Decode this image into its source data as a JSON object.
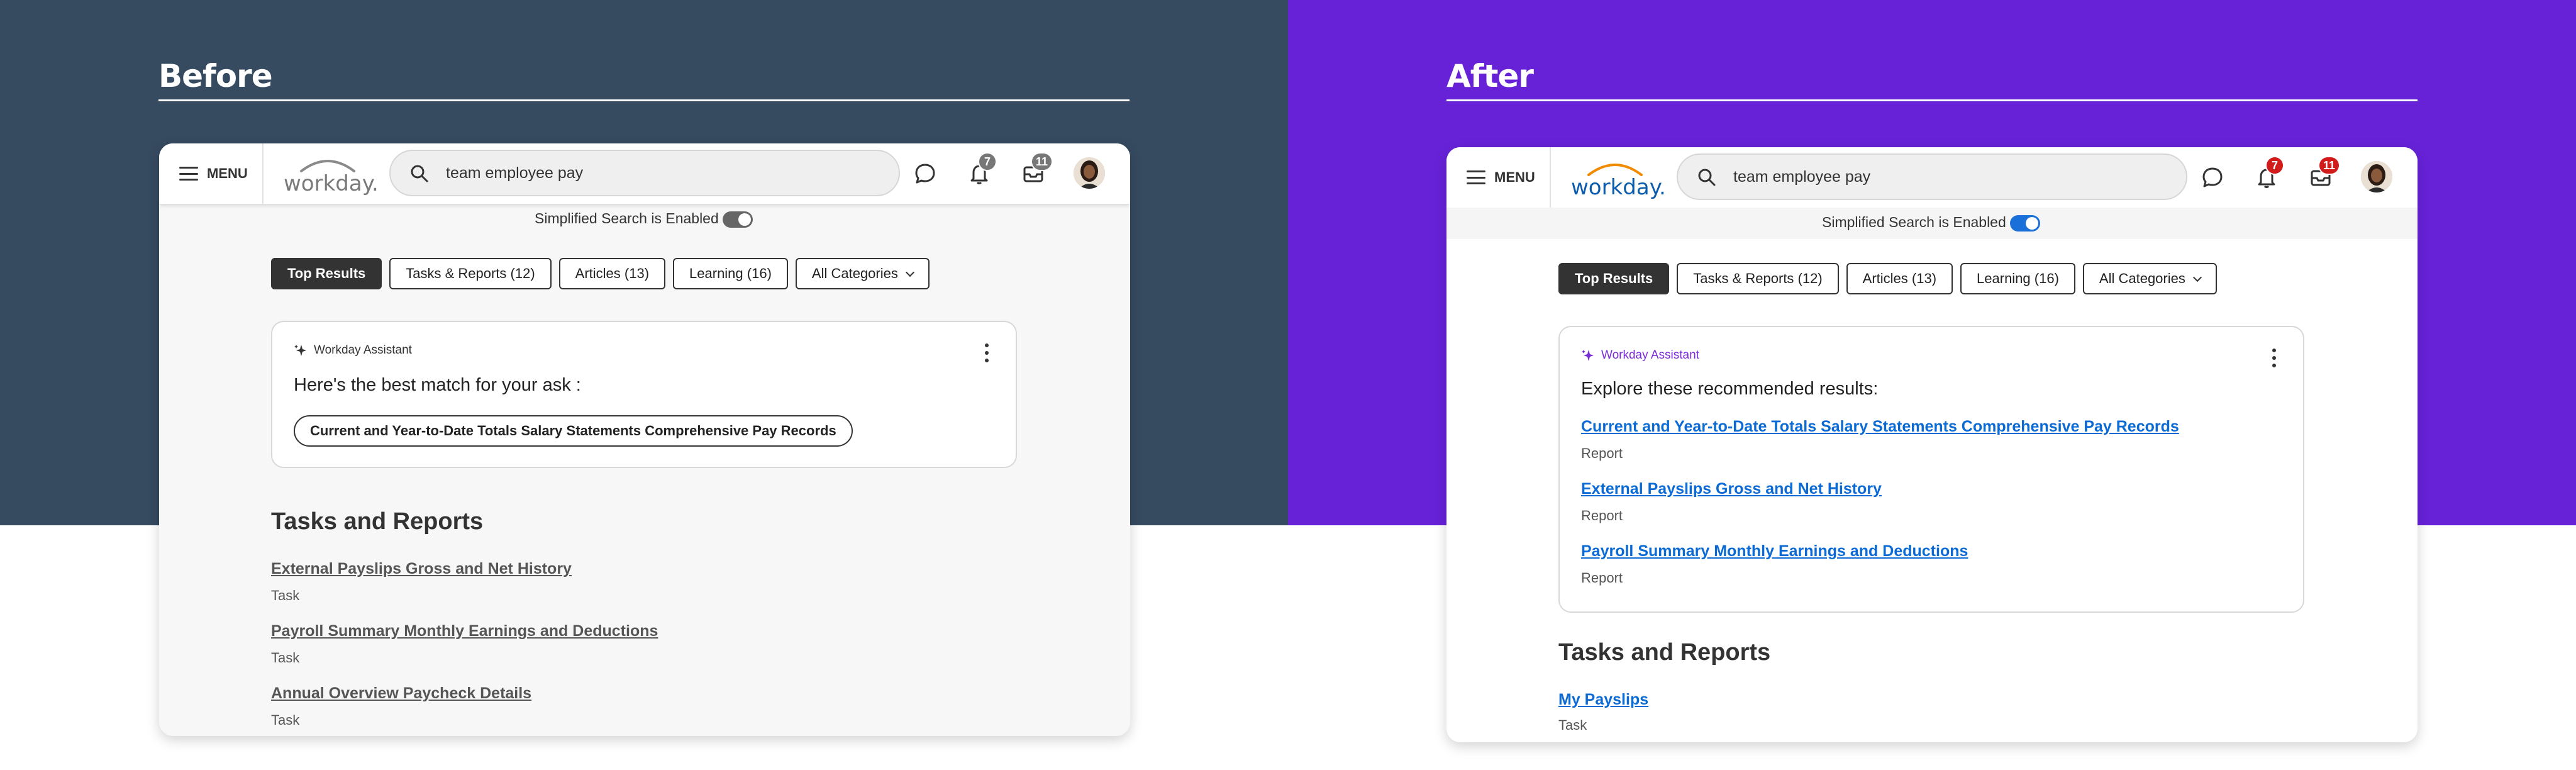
{
  "before": {
    "heading": "Before",
    "menu_label": "MENU",
    "logo_text": "workday.",
    "search_value": "team employee pay",
    "notifications_count": "7",
    "inbox_count": "11",
    "simplified_label": "Simplified Search is Enabled",
    "simplified_toggle_on": false,
    "chips": [
      "Top Results",
      "Tasks & Reports (12)",
      "Articles (13)",
      "Learning (16)",
      "All Categories"
    ],
    "assistant": {
      "label": "Workday Assistant",
      "title": "Here's the best match for your ask :",
      "best_match": "Current and Year-to-Date Totals Salary Statements Comprehensive Pay Records"
    },
    "section_title": "Tasks and Reports",
    "tasks": [
      {
        "title": "External Payslips Gross and Net History",
        "type": "Task"
      },
      {
        "title": "Payroll Summary Monthly Earnings and Deductions",
        "type": "Task"
      },
      {
        "title": "Annual Overview Paycheck Details",
        "type": "Task"
      }
    ]
  },
  "after": {
    "heading": "After",
    "menu_label": "MENU",
    "logo_text": "workday.",
    "search_value": "team employee pay",
    "notifications_count": "7",
    "inbox_count": "11",
    "simplified_label": "Simplified Search is Enabled",
    "simplified_toggle_on": true,
    "chips": [
      "Top Results",
      "Tasks & Reports (12)",
      "Articles (13)",
      "Learning (16)",
      "All Categories"
    ],
    "assistant": {
      "label": "Workday Assistant",
      "title": "Explore these recommended results:",
      "results": [
        {
          "title": "Current and Year-to-Date Totals Salary Statements Comprehensive Pay Records",
          "type": "Report"
        },
        {
          "title": "External Payslips Gross and Net History",
          "type": "Report"
        },
        {
          "title": "Payroll Summary Monthly Earnings and Deductions",
          "type": "Report"
        }
      ]
    },
    "section_title": "Tasks and Reports",
    "tasks": [
      {
        "title": "My Payslips",
        "type": "Task"
      }
    ]
  },
  "colors": {
    "before_bg": "#364a60",
    "after_bg": "#6722d8",
    "link_blue": "#0b6ad4",
    "badge_gray": "#777777",
    "badge_red": "#d21b1b",
    "toggle_on": "#1a6fd8",
    "toggle_off": "#666666",
    "assistant_purple": "#7a2bd8",
    "logo_orange": "#f38b00",
    "logo_blue": "#0b5cab"
  }
}
